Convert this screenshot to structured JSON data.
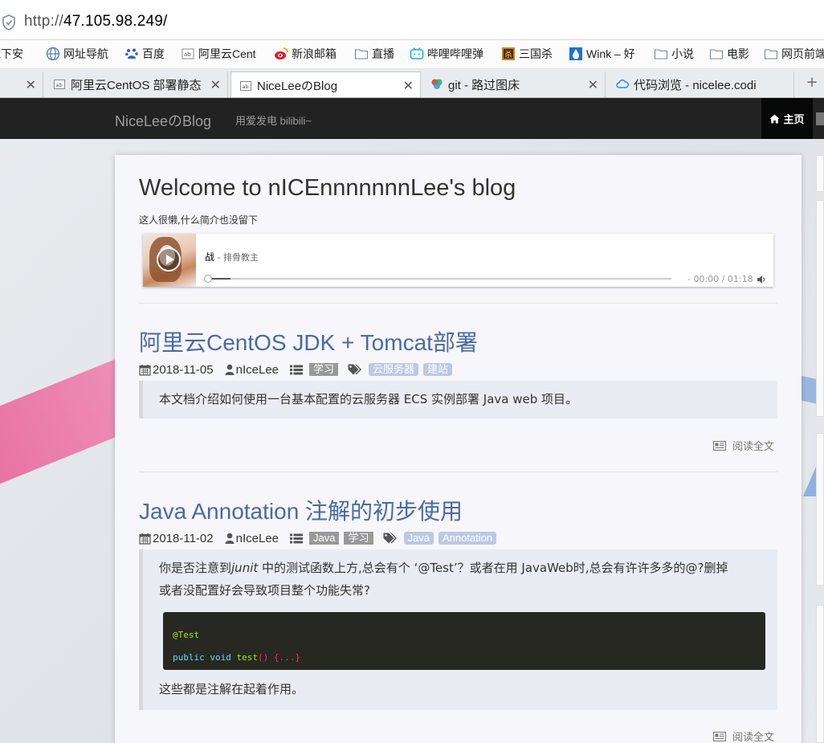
{
  "browser": {
    "address": {
      "protocol": "http://",
      "host": "47.105.98.249/"
    },
    "bookmarks": [
      {
        "label": "x下安",
        "icon": "folder-icon"
      },
      {
        "label": "网址导航",
        "icon": "globe-icon"
      },
      {
        "label": "百度",
        "icon": "baidu-icon"
      },
      {
        "label": "阿里云Cent",
        "icon": "page-icon"
      },
      {
        "label": "新浪邮箱",
        "icon": "weibo-icon"
      },
      {
        "label": "直播",
        "icon": "folder-icon"
      },
      {
        "label": "哔哩哔哩弹",
        "icon": "bilibili-icon"
      },
      {
        "label": "三国杀",
        "icon": "game-icon"
      },
      {
        "label": "Wink – 好",
        "icon": "drop-icon"
      },
      {
        "label": "小说",
        "icon": "folder-icon"
      },
      {
        "label": "电影",
        "icon": "folder-icon"
      },
      {
        "label": "网页前端",
        "icon": "folder-icon"
      }
    ],
    "tabs": [
      {
        "label": "",
        "active": false
      },
      {
        "label": "阿里云CentOS 部署静态",
        "active": false
      },
      {
        "label": "NiceLeeのBlog",
        "active": true
      },
      {
        "label": "git - 路过图床",
        "active": false
      },
      {
        "label": "代码浏览 - nicelee.codi",
        "active": false
      }
    ],
    "tab_close": "✕",
    "new_tab": "+"
  },
  "navbar": {
    "brand": "NiceLeeのBlog",
    "tagline": "用爱发电 bilibili~",
    "home": "主页"
  },
  "blog": {
    "welcome": "Welcome to nICEnnnnnnnLee's blog",
    "intro": "这人很懒,什么简介也没留下"
  },
  "player": {
    "song": "战",
    "artist": " - 排骨教主",
    "time": "- 00:00 / 01:18",
    "progress": 0.05
  },
  "posts": [
    {
      "title": "阿里云CentOS JDK + Tomcat部署",
      "date": "2018-11-05",
      "author": "nIceLee",
      "categories": [
        "学习"
      ],
      "tags": [
        "云服务器",
        "建站"
      ],
      "excerpt": "本文档介绍如何使用一台基本配置的云服务器 ECS 实例部署 Java web 项目。",
      "read_more": "阅读全文"
    },
    {
      "title": "Java Annotation 注解的初步使用",
      "date": "2018-11-02",
      "author": "nIceLee",
      "categories": [
        "Java",
        "学习"
      ],
      "tags": [
        "Java",
        "Annotation"
      ],
      "excerpt_a": "你是否注意到",
      "excerpt_em": "junit",
      "excerpt_b": " 中的测试函数上方,总会有个 ‘@Test’？或者在用 JavaWeb时,总会有许许多多的@?删掉",
      "excerpt_line2": "或者没配置好会导致项目整个功能失常?",
      "code_line1": "@Test",
      "code_kw": "public void",
      "code_fn": "test",
      "code_rest": "() {...}",
      "excerpt_end": "这些都是注解在起着作用。",
      "read_more": "阅读全文"
    }
  ],
  "colors": {
    "navbar": "#222222",
    "link": "#4a6aa5",
    "category": "#999999",
    "tag": "#bcc8e4",
    "code_bg": "#272822"
  }
}
